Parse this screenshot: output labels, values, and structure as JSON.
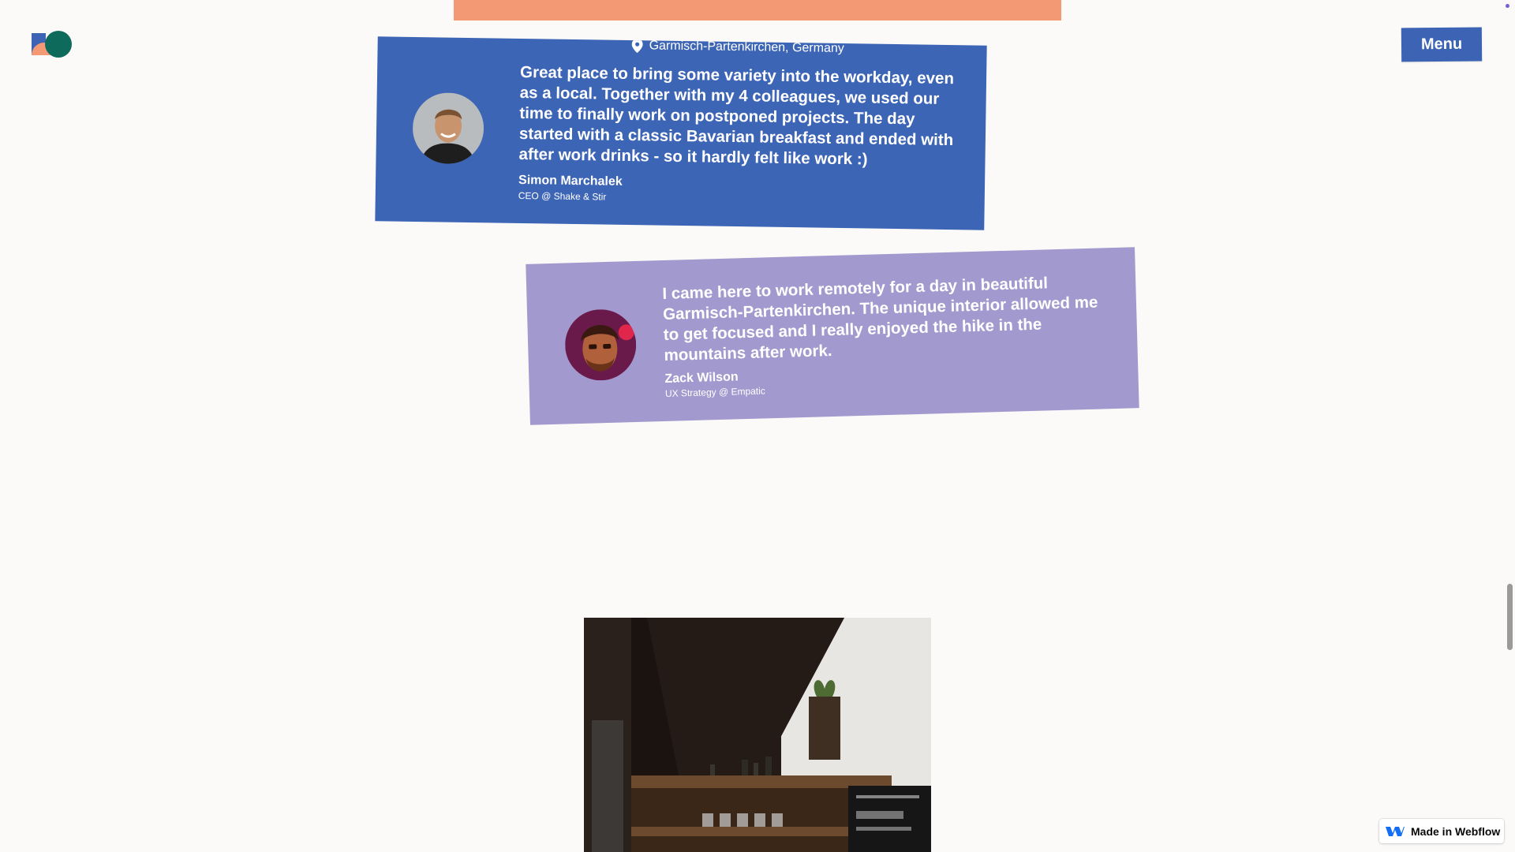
{
  "colors": {
    "background": "#fcfaf8",
    "top_bar": "#f39a75",
    "card_blue": "#3d65b6",
    "card_lavender": "#a29ace",
    "menu_button": "#3c63b4",
    "webflow_blue": "#146ef5"
  },
  "header": {
    "logo_icon": "logo-shapes-icon",
    "menu_label": "Menu"
  },
  "testimonials": [
    {
      "location": "Garmisch-Partenkirchen, Germany",
      "location_icon": "map-pin-icon",
      "quote": "Great place to bring some variety into the workday, even as a local. Together with my 4 colleagues, we used our time to finally work on postponed projects. The day started with a classic Bavarian breakfast and ended with after work drinks - so it hardly felt like work :)",
      "name": "Simon Marchalek",
      "role": "CEO @ Shake & Stir"
    },
    {
      "quote": "I came here to work remotely for a day in beautiful Garmisch-Partenkirchen. The unique interior allowed me to get focused and I really enjoyed the hike in the mountains after work.",
      "name": "Zack Wilson",
      "role": "UX Strategy @ Empatic"
    }
  ],
  "badge": {
    "label": "Made in Webflow",
    "icon": "webflow-icon"
  }
}
